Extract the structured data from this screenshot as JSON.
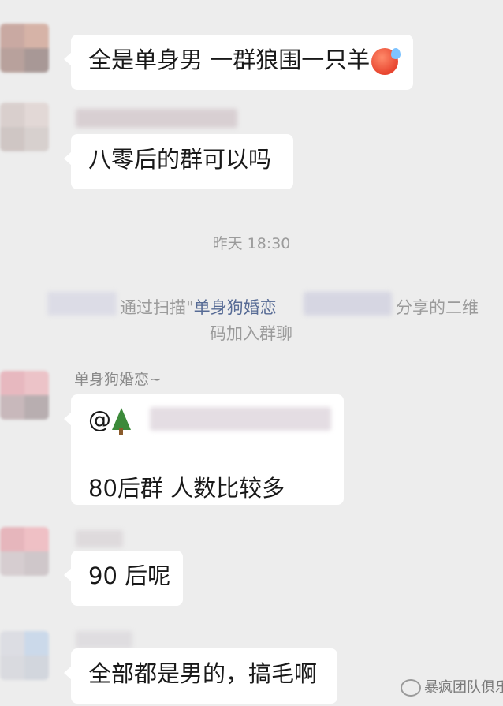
{
  "messages": {
    "m1": {
      "text": "全是单身男  一群狼围一只羊",
      "emoji": "cold-sweat-emoji"
    },
    "m2": {
      "text": "八零后的群可以吗"
    },
    "timestamp": "昨天 18:30",
    "system": {
      "part1": "通过扫描\"",
      "name": "单身狗婚恋",
      "part2": "分享的二维",
      "line2": "码加入群聊"
    },
    "m3": {
      "sender": "单身狗婚恋~",
      "mention": "@",
      "mention_emoji": "tree-emoji",
      "text": "80后群  人数比较多"
    },
    "m4": {
      "text": "90 后呢"
    },
    "m5": {
      "text": "全部都是男的，搞毛啊"
    }
  },
  "watermark": {
    "text": "暴疯团队俱乐部",
    "icon": "wechat-official-account-icon"
  }
}
